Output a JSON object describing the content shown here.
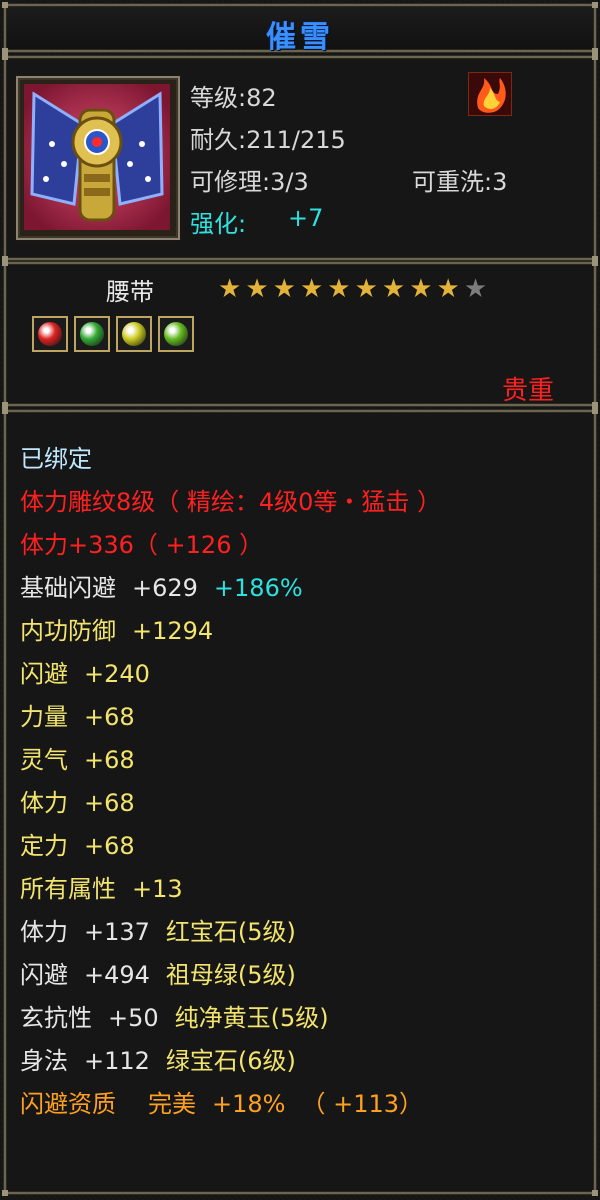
{
  "item": {
    "name": "催雪",
    "slot": "腰带",
    "rarity": "贵重",
    "level": "等级:82",
    "durability": "耐久:211/215",
    "repairable": "可修理:3/3",
    "rewash": "可重洗:3",
    "enhance_label": "强化:",
    "enhance_value": "+7",
    "stars_filled": 9,
    "stars_total": 10,
    "portrait_icon": "belt-item-icon",
    "emblem_icon": "flame-emblem-icon"
  },
  "gems": [
    {
      "icon": "red-gem-icon",
      "color": "#d22"
    },
    {
      "icon": "green-gem-icon",
      "color": "#3a3"
    },
    {
      "icon": "yellow-gem-icon",
      "color": "#cc2"
    },
    {
      "icon": "emerald-gem-icon",
      "color": "#6b2"
    }
  ],
  "attributes": {
    "bound": "已绑定",
    "engrave": "体力雕纹8级（ 精绘：4级0等・猛击 ）",
    "vit_main": "体力+336（ +126 ）",
    "base_dodge_name": "基础闪避",
    "base_dodge_value": "+629",
    "base_dodge_pct": "+186%",
    "inner_def_name": "内功防御",
    "inner_def_value": "+1294",
    "dodge_name": "闪避",
    "dodge_value": "+240",
    "str_name": "力量",
    "str_value": "+68",
    "spirit_name": "灵气",
    "spirit_value": "+68",
    "vit_name": "体力",
    "vit_value": "+68",
    "focus_name": "定力",
    "focus_value": "+68",
    "all_name": "所有属性",
    "all_value": "+13",
    "gem1_name": "体力",
    "gem1_value": "+137",
    "gem1_gem": "红宝石",
    "gem1_lvl": "(5级)",
    "gem2_name": "闪避",
    "gem2_value": "+494",
    "gem2_gem": "祖母绿",
    "gem2_lvl": "(5级)",
    "gem3_name": "玄抗性",
    "gem3_value": "+50",
    "gem3_gem": "纯净黄玉",
    "gem3_lvl": "(5级)",
    "gem4_name": "身法",
    "gem4_value": "+112",
    "gem4_gem": "绿宝石",
    "gem4_lvl": "(6级)",
    "aptitude_name": "闪避资质",
    "aptitude_grade": "完美",
    "aptitude_pct": "+18%",
    "aptitude_bonus": "（ +113）"
  },
  "colors": {
    "title": "#3a8fff",
    "red": "#ff2020",
    "yellow": "#f2e46c",
    "cyan": "#2ee0e0",
    "orange": "#ffa020"
  }
}
